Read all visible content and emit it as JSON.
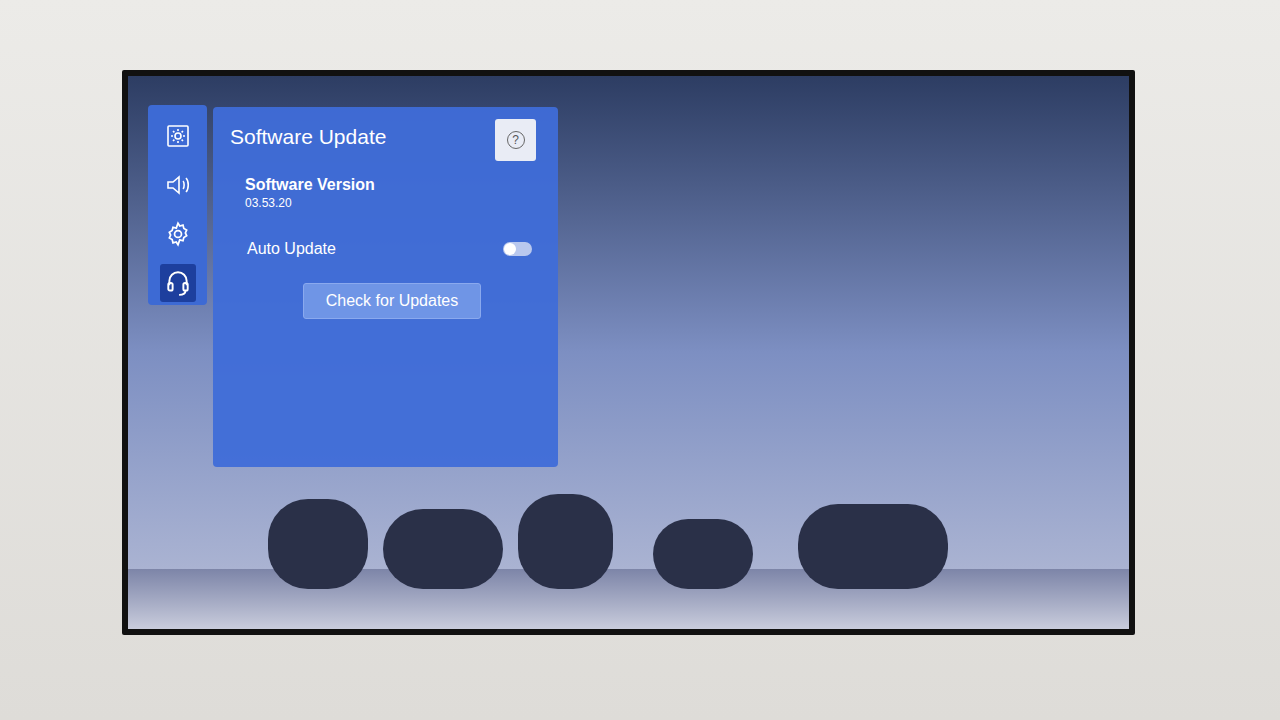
{
  "sidebar": {
    "items": [
      {
        "kind": "picture",
        "selected": false
      },
      {
        "kind": "sound",
        "selected": false
      },
      {
        "kind": "general",
        "selected": false
      },
      {
        "kind": "support",
        "selected": true
      }
    ]
  },
  "panel": {
    "title": "Software Update",
    "help": "?",
    "software_version": {
      "label": "Software Version",
      "value": "03.53.20"
    },
    "auto_update": {
      "label": "Auto Update",
      "on": false
    },
    "check_button": "Check for Updates"
  }
}
